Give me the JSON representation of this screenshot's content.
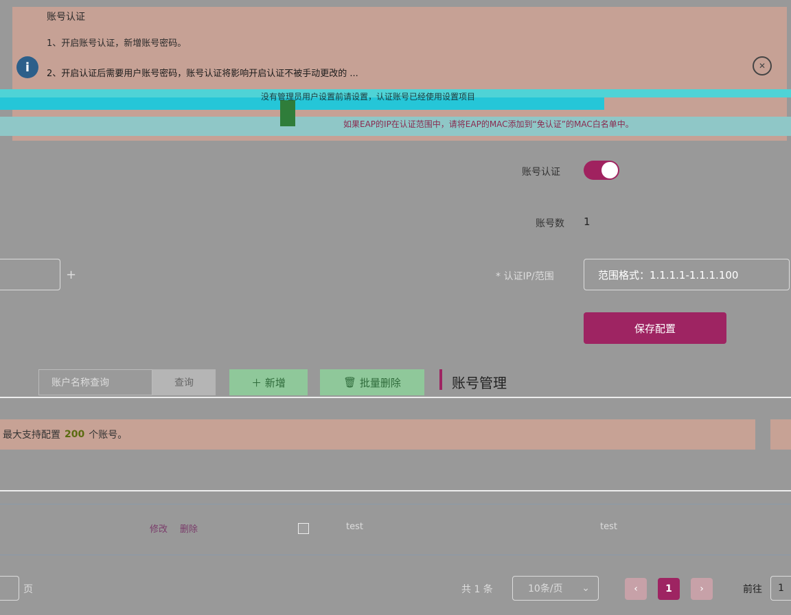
{
  "notice": {
    "title": "账号认证",
    "line1": "1、开启账号认证，新增账号密码。",
    "line2": "2、开启认证后需要用户账号密码，账号认证将影响开启认证不被手动更改的 ...",
    "line3": "没有管理员用户设置前请设置，认证账号已经使用设置项目",
    "line4": "如果EAP的IP在认证范围中，请将EAP的MAC添加到“免认证”的MAC白名单中。"
  },
  "form": {
    "account_auth_label": "账号认证",
    "account_auth_enabled": true,
    "account_count_label": "账号数",
    "account_count_value": "1",
    "ip_range_label": "* 认证IP/范围",
    "ip_range_placeholder": "范围格式：1.1.1.1-1.1.1.100",
    "save_button": "保存配置"
  },
  "toolbar": {
    "search_placeholder": "账户名称查询",
    "query_button": "查询",
    "add_button": "新增",
    "bulk_delete_button": "批量删除",
    "section_title": "账号管理"
  },
  "info": {
    "prefix": "最大支持配置",
    "count": "200",
    "suffix": "个账号。"
  },
  "table": {
    "row": {
      "edit": "修改",
      "delete": "删除",
      "name": "test",
      "password": "test"
    }
  },
  "pager": {
    "left_label": "页",
    "total": "共 1 条",
    "page_size": "10条/页",
    "current_page": "1",
    "goto_label": "前往",
    "goto_value": "1"
  },
  "colors": {
    "accent": "#9e2462",
    "notice_bg": "#c6a195"
  }
}
